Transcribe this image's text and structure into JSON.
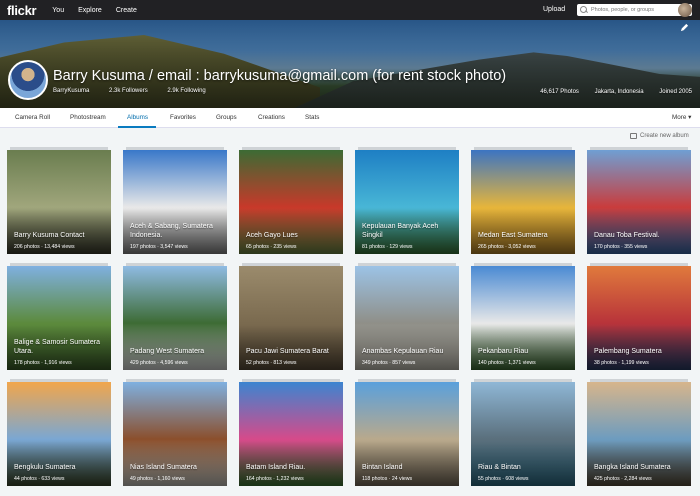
{
  "nav": {
    "logo": "flickr",
    "links": [
      "You",
      "Explore",
      "Create"
    ],
    "upload": "Upload",
    "search_placeholder": "Photos, people, or groups"
  },
  "profile": {
    "name": "Barry Kusuma / email : barrykusuma@gmail.com (for rent stock photo)",
    "username": "BarryKusuma",
    "followers": "2.3k Followers",
    "following": "2.9k Following",
    "photos": "46,617 Photos",
    "location": "Jakarta, Indonesia",
    "joined": "Joined 2005"
  },
  "tabs": [
    "Camera Roll",
    "Photostream",
    "Albums",
    "Favorites",
    "Groups",
    "Creations",
    "Stats"
  ],
  "active_tab": "Albums",
  "more_label": "More ▾",
  "create_album": "Create new album",
  "albums": [
    {
      "title": "Barry Kusuma Contact",
      "count": "206 photos  ·  13,484 views",
      "colors": [
        "#6a7d4f",
        "#a0a67c",
        "#3b3d2e"
      ]
    },
    {
      "title": "Aceh & Sabang, Sumatera Indonesia.",
      "count": "197 photos  ·  3,547 views",
      "colors": [
        "#3978c9",
        "#e8e8e8",
        "#8b8b8b"
      ]
    },
    {
      "title": "Aceh Gayo Lues",
      "count": "65 photos  ·  235 views",
      "colors": [
        "#3c6b34",
        "#c8392a",
        "#6f8b45"
      ]
    },
    {
      "title": "Kepulauan Banyak Aceh Singkil",
      "count": "81 photos  ·  129 views",
      "colors": [
        "#1e7fc4",
        "#48b6d6",
        "#3b7a3a"
      ]
    },
    {
      "title": "Medan East Sumatera",
      "count": "265 photos  ·  3,052 views",
      "colors": [
        "#3c74c2",
        "#e6b53b",
        "#b8862a"
      ]
    },
    {
      "title": "Danau Toba Festival.",
      "count": "170 photos  ·  355 views",
      "colors": [
        "#6f9fd3",
        "#c93c3c",
        "#3b6fb0"
      ]
    },
    {
      "title": "Balige & Samosir Sumatera Utara.",
      "count": "178 photos  ·  1,916 views",
      "colors": [
        "#7fb0e0",
        "#5c8a3c",
        "#3c5f2a"
      ]
    },
    {
      "title": "Padang West Sumatera",
      "count": "429 photos  ·  4,596 views",
      "colors": [
        "#8fbbe3",
        "#3d6b34",
        "#e0e0e0"
      ]
    },
    {
      "title": "Pacu Jawi Sumatera Barat",
      "count": "52 photos  ·  813 views",
      "colors": [
        "#9b8b6c",
        "#7a6a4f",
        "#5c4e3a"
      ]
    },
    {
      "title": "Anambas Kepulauan Riau",
      "count": "349 photos  ·  857 views",
      "colors": [
        "#9cc3e6",
        "#8f8f88",
        "#c7c3b8"
      ]
    },
    {
      "title": "Pekanbaru Riau",
      "count": "140 photos  ·  1,371 views",
      "colors": [
        "#4a8ad3",
        "#e8e8e8",
        "#3d6b34"
      ]
    },
    {
      "title": "Palembang Sumatera",
      "count": "38 photos  ·  1,199 views",
      "colors": [
        "#e07a3c",
        "#b8333a",
        "#2a3f6b"
      ]
    },
    {
      "title": "Bengkulu Sumatera",
      "count": "44 photos  ·  633 views",
      "colors": [
        "#f1a64c",
        "#7aa7d3",
        "#3d4a2c"
      ]
    },
    {
      "title": "Nias Island Sumatera",
      "count": "49 photos  ·  1,160 views",
      "colors": [
        "#7fb0e0",
        "#8b4f2c",
        "#c8c8c0"
      ]
    },
    {
      "title": "Batam Island Riau.",
      "count": "164 photos  ·  1,232 views",
      "colors": [
        "#3c85d0",
        "#d64a8a",
        "#3d7a34"
      ]
    },
    {
      "title": "Bintan Island",
      "count": "118 photos  ·  24 views",
      "colors": [
        "#5aa0dc",
        "#b9a98c",
        "#7a6e5c"
      ]
    },
    {
      "title": "Riau & Bintan",
      "count": "55 photos  ·  608 views",
      "colors": [
        "#8fb7d6",
        "#5a6f7c",
        "#2f6f88"
      ]
    },
    {
      "title": "Bangka Island Sumatera",
      "count": "425 photos  ·  2,284 views",
      "colors": [
        "#d7b58b",
        "#6d9cbf",
        "#5a4e3c"
      ]
    }
  ]
}
